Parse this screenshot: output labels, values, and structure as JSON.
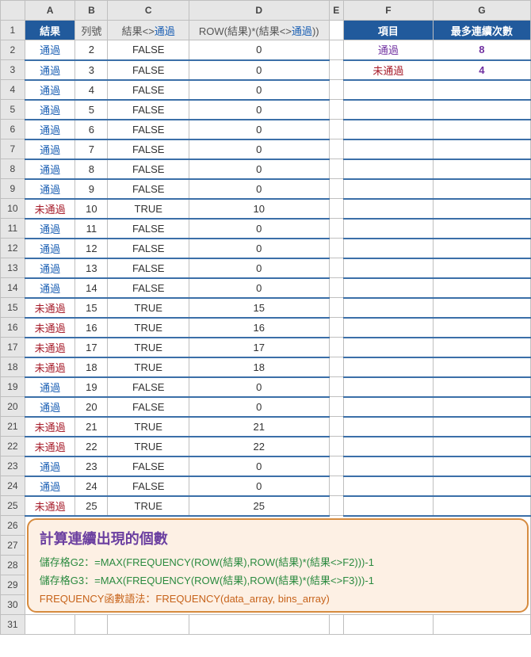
{
  "columns": [
    "A",
    "B",
    "C",
    "D",
    "E",
    "F",
    "G"
  ],
  "row_numbers": [
    1,
    2,
    3,
    4,
    5,
    6,
    7,
    8,
    9,
    10,
    11,
    12,
    13,
    14,
    15,
    16,
    17,
    18,
    19,
    20,
    21,
    22,
    23,
    24,
    25,
    26,
    27,
    28,
    29,
    30,
    31
  ],
  "headers": {
    "a1": "結果",
    "b1": "列號",
    "c1_part1": "結果<>",
    "c1_part2": "通過",
    "d1_part1": "ROW(結果)*(結果<>",
    "d1_part2": "通過",
    "d1_part3": "))",
    "f1": "項目",
    "g1": "最多連續次數"
  },
  "summary": {
    "f2": "通過",
    "g2": "8",
    "f3": "未通過",
    "g3": "4"
  },
  "rows": [
    {
      "a": "通過",
      "b": "2",
      "c": "FALSE",
      "d": "0"
    },
    {
      "a": "通過",
      "b": "3",
      "c": "FALSE",
      "d": "0"
    },
    {
      "a": "通過",
      "b": "4",
      "c": "FALSE",
      "d": "0"
    },
    {
      "a": "通過",
      "b": "5",
      "c": "FALSE",
      "d": "0"
    },
    {
      "a": "通過",
      "b": "6",
      "c": "FALSE",
      "d": "0"
    },
    {
      "a": "通過",
      "b": "7",
      "c": "FALSE",
      "d": "0"
    },
    {
      "a": "通過",
      "b": "8",
      "c": "FALSE",
      "d": "0"
    },
    {
      "a": "通過",
      "b": "9",
      "c": "FALSE",
      "d": "0"
    },
    {
      "a": "未通過",
      "b": "10",
      "c": "TRUE",
      "d": "10"
    },
    {
      "a": "通過",
      "b": "11",
      "c": "FALSE",
      "d": "0"
    },
    {
      "a": "通過",
      "b": "12",
      "c": "FALSE",
      "d": "0"
    },
    {
      "a": "通過",
      "b": "13",
      "c": "FALSE",
      "d": "0"
    },
    {
      "a": "通過",
      "b": "14",
      "c": "FALSE",
      "d": "0"
    },
    {
      "a": "未通過",
      "b": "15",
      "c": "TRUE",
      "d": "15"
    },
    {
      "a": "未通過",
      "b": "16",
      "c": "TRUE",
      "d": "16"
    },
    {
      "a": "未通過",
      "b": "17",
      "c": "TRUE",
      "d": "17"
    },
    {
      "a": "未通過",
      "b": "18",
      "c": "TRUE",
      "d": "18"
    },
    {
      "a": "通過",
      "b": "19",
      "c": "FALSE",
      "d": "0"
    },
    {
      "a": "通過",
      "b": "20",
      "c": "FALSE",
      "d": "0"
    },
    {
      "a": "未通過",
      "b": "21",
      "c": "TRUE",
      "d": "21"
    },
    {
      "a": "未通過",
      "b": "22",
      "c": "TRUE",
      "d": "22"
    },
    {
      "a": "通過",
      "b": "23",
      "c": "FALSE",
      "d": "0"
    },
    {
      "a": "通過",
      "b": "24",
      "c": "FALSE",
      "d": "0"
    },
    {
      "a": "未通過",
      "b": "25",
      "c": "TRUE",
      "d": "25"
    }
  ],
  "note": {
    "title": "計算連續出現的個數",
    "line1": "儲存格G2：=MAX(FREQUENCY(ROW(結果),ROW(結果)*(結果<>F2)))-1",
    "line2": "儲存格G3：=MAX(FREQUENCY(ROW(結果),ROW(結果)*(結果<>F3)))-1",
    "line3": "FREQUENCY函數語法：FREQUENCY(data_array, bins_array)"
  },
  "pass_text": "通過",
  "fail_text": "未通過"
}
